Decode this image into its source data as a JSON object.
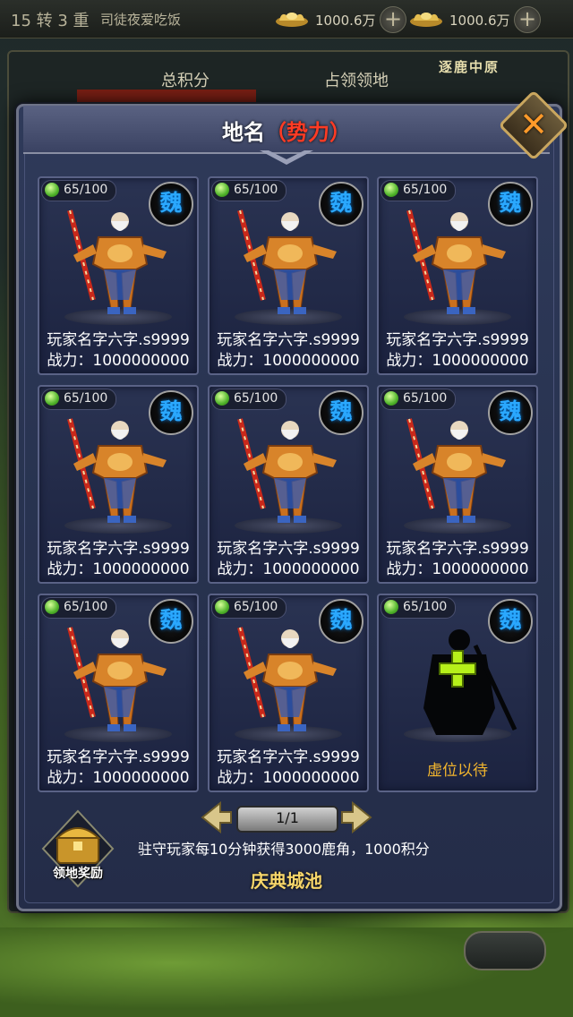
{
  "topbar": {
    "rebirth": "15 转 3 重",
    "player_name": "司徒夜爱吃饭",
    "currencies": [
      {
        "icon": "gold-ingot-icon",
        "amount": "1000.6万"
      },
      {
        "icon": "silver-ingot-icon",
        "amount": "1000.6万"
      }
    ]
  },
  "background_panel": {
    "total_score_label": "总积分",
    "occupied_label": "占领领地",
    "event_title": "逐鹿中原"
  },
  "dialog": {
    "title_main": "地名",
    "title_sub": "（势力）",
    "close_label": "✕"
  },
  "slots": [
    {
      "level": "65/100",
      "faction": "魏",
      "name": "玩家名字六字.s9999",
      "power": "战力：1000000000",
      "occupied": true
    },
    {
      "level": "65/100",
      "faction": "魏",
      "name": "玩家名字六字.s9999",
      "power": "战力：1000000000",
      "occupied": true
    },
    {
      "level": "65/100",
      "faction": "魏",
      "name": "玩家名字六字.s9999",
      "power": "战力：1000000000",
      "occupied": true
    },
    {
      "level": "65/100",
      "faction": "魏",
      "name": "玩家名字六字.s9999",
      "power": "战力：1000000000",
      "occupied": true
    },
    {
      "level": "65/100",
      "faction": "魏",
      "name": "玩家名字六字.s9999",
      "power": "战力：1000000000",
      "occupied": true
    },
    {
      "level": "65/100",
      "faction": "魏",
      "name": "玩家名字六字.s9999",
      "power": "战力：1000000000",
      "occupied": true
    },
    {
      "level": "65/100",
      "faction": "魏",
      "name": "玩家名字六字.s9999",
      "power": "战力：1000000000",
      "occupied": true
    },
    {
      "level": "65/100",
      "faction": "魏",
      "name": "玩家名字六字.s9999",
      "power": "战力：1000000000",
      "occupied": true
    },
    {
      "level": "65/100",
      "faction": "魏",
      "vacant_label": "虚位以待",
      "occupied": false
    }
  ],
  "pager": {
    "label": "1/1"
  },
  "reward_button": {
    "label": "领地奖励"
  },
  "tip": "驻守玩家每10分钟获得3000鹿角，1000积分",
  "city_name": "庆典城池",
  "colors": {
    "accent_gold": "#f7d66a",
    "faction_blue": "#2aa8ff",
    "title_red": "#ff3b24",
    "vacant_orange": "#f2b52e"
  }
}
